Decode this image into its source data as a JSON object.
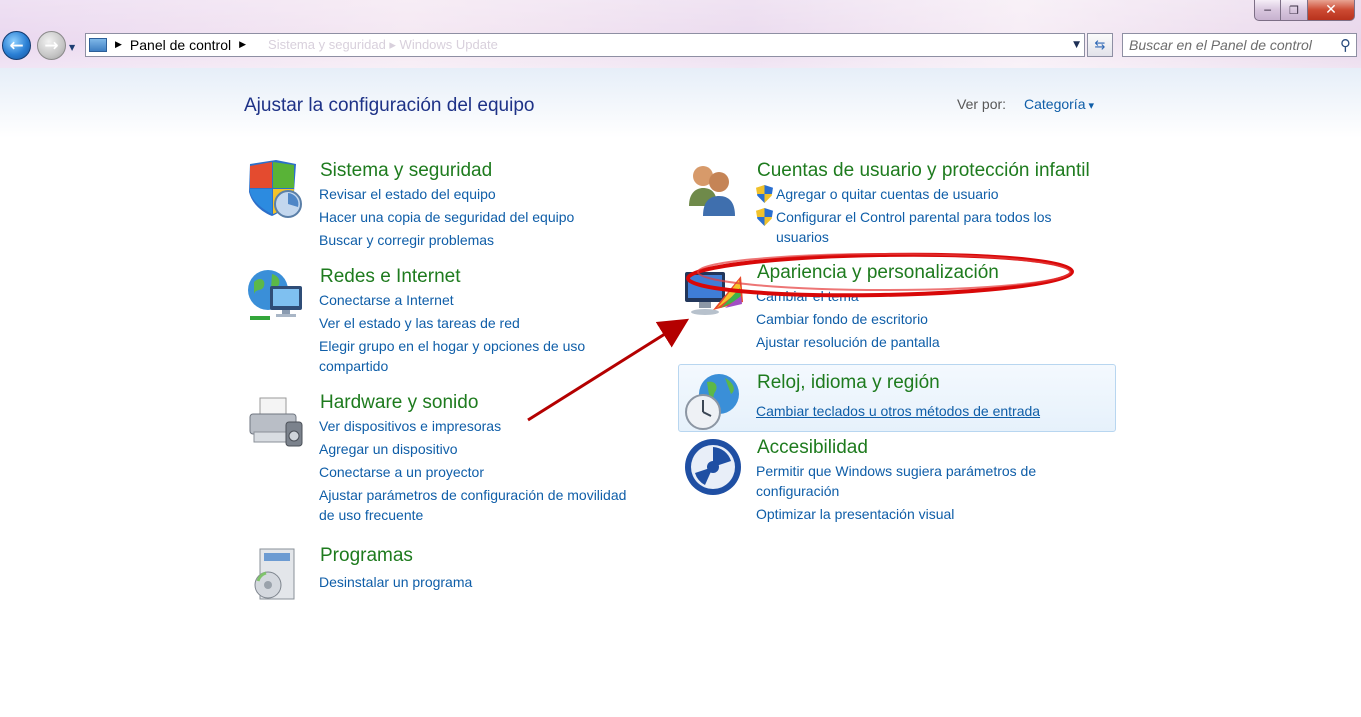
{
  "window": {
    "minimize_icon": "minimize-icon",
    "maximize_icon": "maximize-icon",
    "close_icon": "close-icon"
  },
  "address_bar": {
    "segments": [
      "Panel de control"
    ],
    "faded_text": "Sistema y seguridad   ▸   Windows Update"
  },
  "search": {
    "placeholder": "Buscar en el Panel de control"
  },
  "header": {
    "title": "Ajustar la configuración del equipo",
    "view_by_label": "Ver por:",
    "view_by_value": "Categoría"
  },
  "categories_left": [
    {
      "title": "Sistema y seguridad",
      "icon": "shield-icon",
      "links": [
        "Revisar el estado del equipo",
        "Hacer una copia de seguridad del equipo",
        "Buscar y corregir problemas"
      ]
    },
    {
      "title": "Redes e Internet",
      "icon": "network-globe-icon",
      "links": [
        "Conectarse a Internet",
        "Ver el estado y las tareas de red",
        "Elegir grupo en el hogar y opciones de uso",
        "compartido"
      ]
    },
    {
      "title": "Hardware y sonido",
      "icon": "printer-icon",
      "links": [
        "Ver dispositivos e impresoras",
        "Agregar un dispositivo",
        "Conectarse a un proyector",
        "Ajustar parámetros de configuración de movilidad",
        "de uso frecuente"
      ]
    },
    {
      "title": "Programas",
      "icon": "programs-box-icon",
      "links": [
        "Desinstalar un programa"
      ]
    }
  ],
  "categories_right": [
    {
      "title": "Cuentas de usuario y protección infantil",
      "icon": "users-icon",
      "links": [
        "Agregar o quitar cuentas de usuario",
        "Configurar el Control parental para todos los",
        "usuarios"
      ]
    },
    {
      "title": "Apariencia y personalización",
      "icon": "monitor-palette-icon",
      "links": [
        "Cambiar el tema",
        "Cambiar fondo de escritorio",
        "Ajustar resolución de pantalla"
      ]
    },
    {
      "title": "Reloj, idioma y región",
      "icon": "globe-clock-icon",
      "links": [
        "Cambiar teclados u otros métodos de entrada"
      ]
    },
    {
      "title": "Accesibilidad",
      "icon": "accessibility-icon",
      "links": [
        "Permitir que Windows sugiera parámetros de",
        "configuración",
        "Optimizar la presentación visual"
      ]
    }
  ],
  "colors": {
    "title_green": "#1e7b1e",
    "link_blue": "#0f5ea8",
    "heading_blue": "#1e3287",
    "annotation_red": "#cc0a0a"
  }
}
